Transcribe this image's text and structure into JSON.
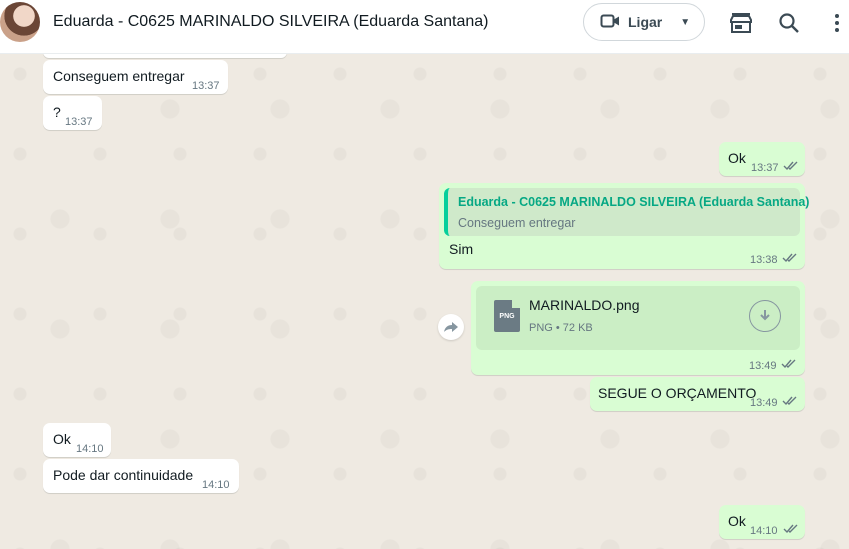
{
  "header": {
    "title": "Eduarda - C0625 MARINALDO SILVEIRA (Eduarda Santana)",
    "call_label": "Ligar"
  },
  "messages": [
    {
      "dir": "in",
      "text": "Conseguem entregar",
      "time": "13:37"
    },
    {
      "dir": "in",
      "text": "?",
      "time": "13:37"
    },
    {
      "dir": "out",
      "text": "Ok",
      "time": "13:37"
    },
    {
      "dir": "out",
      "quote_author": "Eduarda - C0625 MARINALDO SILVEIRA (Eduarda Santana)",
      "quote_text": "Conseguem entregar",
      "text": "Sim",
      "time": "13:38"
    },
    {
      "dir": "out",
      "doc_name": "MARINALDO.png",
      "doc_type": "PNG",
      "doc_size": "72 KB",
      "doc_meta": "PNG • 72 KB",
      "time": "13:49"
    },
    {
      "dir": "out",
      "text": "SEGUE O ORÇAMENTO",
      "time": "13:49"
    },
    {
      "dir": "in",
      "text": "Ok",
      "time": "14:10"
    },
    {
      "dir": "in",
      "text": "Pode dar continuidade",
      "time": "14:10"
    },
    {
      "dir": "out",
      "text": "Ok",
      "time": "14:10"
    }
  ],
  "colors": {
    "outgoing_bubble": "#d9fdd3",
    "incoming_bubble": "#ffffff",
    "chat_background": "#efeae2",
    "quote_accent": "#06cf9c",
    "read_ticks": "#667781"
  },
  "icons": [
    "video-call-icon",
    "dropdown-caret-icon",
    "store-icon",
    "search-icon",
    "menu-icon",
    "double-check-icon",
    "document-icon",
    "download-icon",
    "forward-icon"
  ]
}
